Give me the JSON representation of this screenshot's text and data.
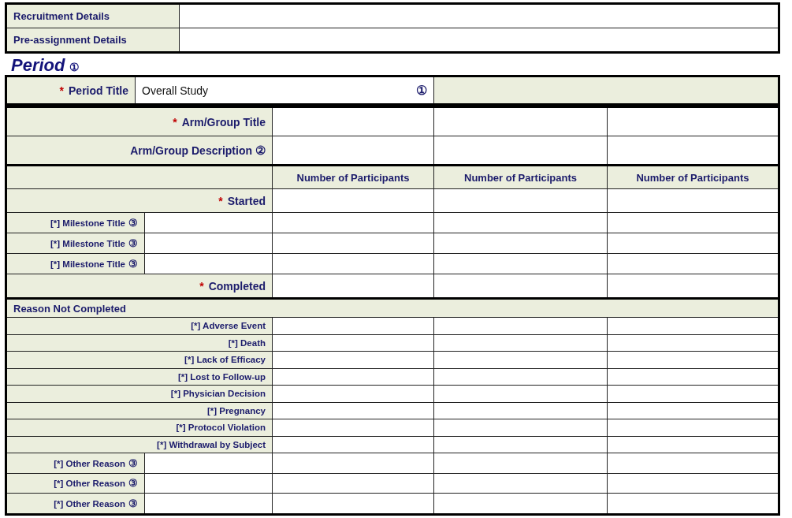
{
  "top_rows": [
    {
      "label": "Recruitment Details"
    },
    {
      "label": "Pre-assignment Details"
    }
  ],
  "period": {
    "heading": "Period",
    "note": "①",
    "title_row": {
      "mark": "*",
      "label": "Period Title",
      "value": "Overall Study",
      "note": "①"
    }
  },
  "arm_rows": [
    {
      "mark": "*",
      "label": "Arm/Group Title"
    },
    {
      "label": "Arm/Group Description",
      "note": "②"
    }
  ],
  "participants": {
    "columns": [
      "Number of Participants",
      "Number of Participants",
      "Number of Participants"
    ],
    "rows": [
      {
        "kind": "total",
        "mark": "*",
        "label": "Started"
      },
      {
        "kind": "milestone",
        "label": "[*] Milestone Title",
        "note": "③"
      },
      {
        "kind": "milestone",
        "label": "[*] Milestone Title",
        "note": "③"
      },
      {
        "kind": "milestone",
        "label": "[*] Milestone Title",
        "note": "③"
      },
      {
        "kind": "total",
        "mark": "*",
        "label": "Completed"
      }
    ]
  },
  "reasons": {
    "heading": "Reason Not Completed",
    "rows": [
      {
        "kind": "fixed",
        "label": "[*] Adverse Event"
      },
      {
        "kind": "fixed",
        "label": "[*] Death"
      },
      {
        "kind": "fixed",
        "label": "[*] Lack of Efficacy"
      },
      {
        "kind": "fixed",
        "label": "[*] Lost to Follow-up"
      },
      {
        "kind": "fixed",
        "label": "[*] Physician Decision"
      },
      {
        "kind": "fixed",
        "label": "[*] Pregnancy"
      },
      {
        "kind": "fixed",
        "label": "[*] Protocol Violation"
      },
      {
        "kind": "fixed",
        "label": "[*] Withdrawal by Subject"
      },
      {
        "kind": "other",
        "label": "[*] Other Reason",
        "note": "③"
      },
      {
        "kind": "other",
        "label": "[*] Other Reason",
        "note": "③"
      },
      {
        "kind": "other",
        "label": "[*] Other Reason",
        "note": "③"
      }
    ]
  }
}
